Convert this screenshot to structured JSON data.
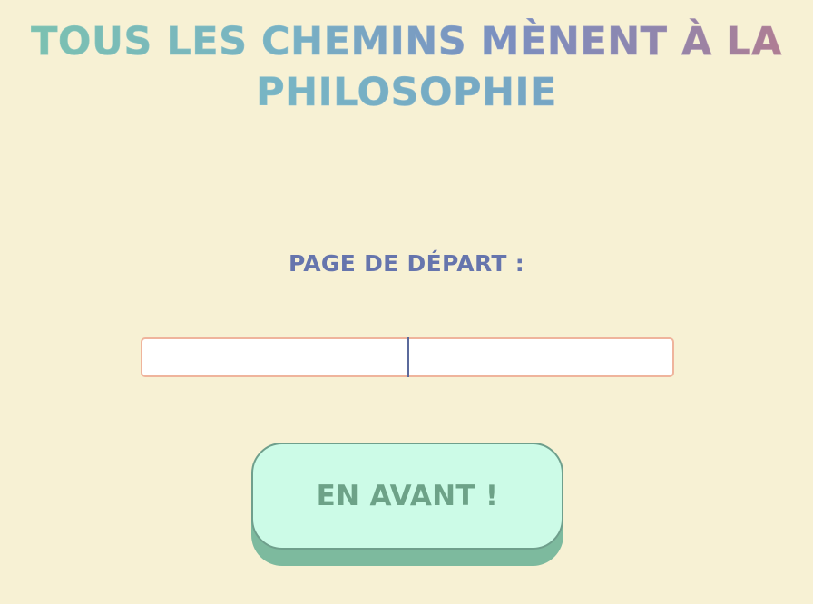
{
  "header": {
    "title_line1": "TOUS LES CHEMINS MÈNENT À LA",
    "title_line2": "PHILOSOPHIE"
  },
  "form": {
    "label": "PAGE DE DÉPART :",
    "input_value": "",
    "input_placeholder": "",
    "submit_label": "EN AVANT !"
  },
  "colors": {
    "background": "#f7f1d4",
    "title_gradient_start": "#7cc3ae",
    "title_gradient_end": "#b77c8d",
    "label": "#6675ad",
    "input_border": "#efb49c",
    "button_fill": "#ccfbe7",
    "button_shadow": "#7dba9e",
    "button_text": "#6da288"
  }
}
